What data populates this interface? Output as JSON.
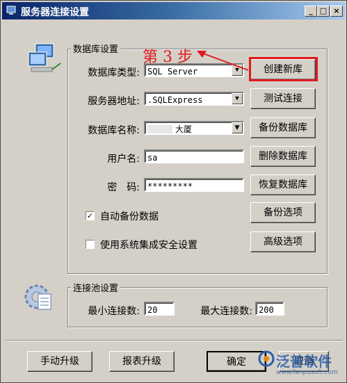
{
  "window": {
    "title": "服务器连接设置"
  },
  "db_settings": {
    "legend": "数据库设置",
    "db_type_label": "数据库类型:",
    "db_type_value": "SQL Server",
    "server_label": "服务器地址:",
    "server_value": ".SQLExpress",
    "db_name_label": "数据库名称:",
    "db_name_value": "大厦",
    "user_label": "用户名:",
    "user_value": "sa",
    "password_label": "密　码:",
    "password_value": "*********",
    "auto_backup_label": "自动备份数据",
    "auto_backup_checked": true,
    "integrated_security_label": "使用系统集成安全设置",
    "integrated_security_checked": false
  },
  "actions": {
    "create_db": "创建新库",
    "test_connection": "测试连接",
    "backup_db": "备份数据库",
    "delete_db": "删除数据库",
    "restore_db": "恢复数据库",
    "backup_options": "备份选项",
    "advanced_options": "高级选项"
  },
  "pool_settings": {
    "legend": "连接池设置",
    "min_label": "最小连接数:",
    "min_value": "20",
    "max_label": "最大连接数:",
    "max_value": "200"
  },
  "footer": {
    "manual_upgrade": "手动升级",
    "report_upgrade": "报表升级",
    "ok": "确定",
    "cancel": "取消"
  },
  "annotation": {
    "step_text": "第 3 步",
    "color": "#e0191e"
  },
  "watermark": {
    "brand": "泛普软件",
    "url": "www.fanpusoft.com"
  }
}
